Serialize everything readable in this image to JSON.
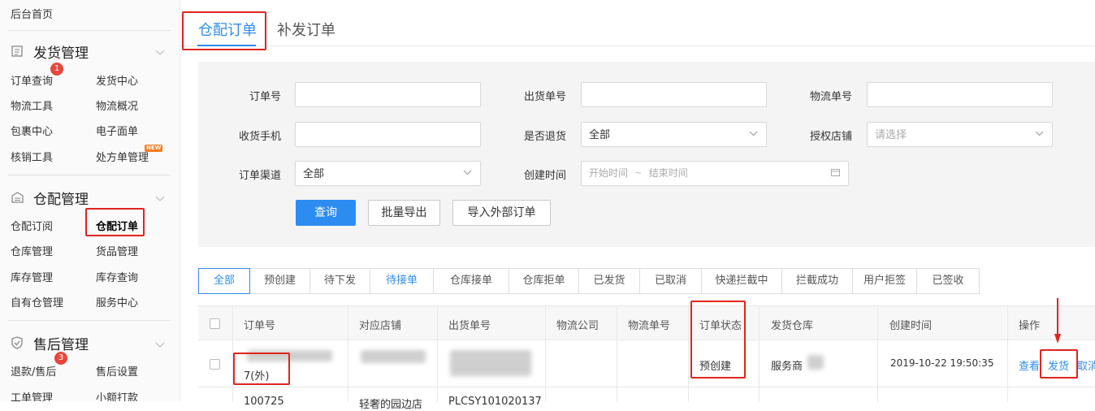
{
  "sidebar": {
    "home": "后台首页",
    "sections": [
      {
        "title": "发货管理",
        "icon": "list-icon"
      },
      {
        "title": "仓配管理",
        "icon": "warehouse-icon"
      },
      {
        "title": "售后管理",
        "icon": "shield-check-icon"
      }
    ],
    "ship": [
      "订单查询",
      "发货中心",
      "物流工具",
      "物流概况",
      "包裹中心",
      "电子面单",
      "核销工具",
      "处方单管理"
    ],
    "wh": [
      "仓配订阅",
      "仓配订单",
      "仓库管理",
      "货品管理",
      "库存管理",
      "库存查询",
      "自有仓管理",
      "服务中心"
    ],
    "after": [
      "退款/售后",
      "售后设置",
      "工单管理",
      "小额打款"
    ],
    "badges": {
      "b1": "1",
      "b3": "3"
    },
    "new_tag": "NEW"
  },
  "tabs": {
    "t1": "仓配订单",
    "t2": "补发订单"
  },
  "filters": {
    "order_no": "订单号",
    "out_no": "出货单号",
    "logistics_no": "物流单号",
    "phone": "收货手机",
    "returned": "是否退货",
    "returned_value": "全部",
    "store": "授权店铺",
    "store_placeholder": "请选择",
    "channel": "订单渠道",
    "channel_value": "全部",
    "created": "创建时间",
    "start_placeholder": "开始时间",
    "tilde": "~",
    "end_placeholder": "结束时间"
  },
  "buttons": {
    "query": "查询",
    "export": "批量导出",
    "import": "导入外部订单"
  },
  "status_tabs": [
    "全部",
    "预创建",
    "待下发",
    "待接单",
    "仓库接单",
    "仓库拒单",
    "已发货",
    "已取消",
    "快递拦截中",
    "拦截成功",
    "用户拒签",
    "已签收"
  ],
  "table": {
    "headers": [
      "订单号",
      "对应店铺",
      "出货单号",
      "物流公司",
      "物流单号",
      "订单状态",
      "发货仓库",
      "创建时间",
      "操作"
    ],
    "row1": {
      "order_no_suffix": "7(外)",
      "status": "预创建",
      "warehouse": "服务商",
      "created": "2019-10-22 19:50:35",
      "actions": [
        "查看",
        "发货",
        "取消"
      ]
    },
    "row2": {
      "order_no": "100725",
      "store": "轻奢的园边店",
      "out_no": "PLCSY101020137"
    }
  },
  "colors": {
    "accent": "#2d8cf0",
    "highlight": "#e0251d",
    "badge": "#e8463c"
  }
}
